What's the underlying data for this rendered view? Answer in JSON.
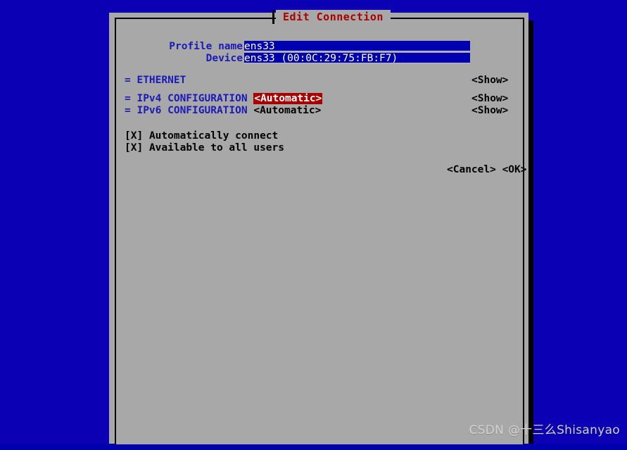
{
  "desktop": {
    "background_color": "#0b00b3"
  },
  "dialog": {
    "title": "Edit Connection",
    "title_color": "#aa0000",
    "panel_color": "#a8a8a8",
    "fields": {
      "profile_name": {
        "label": "Profile name",
        "value": "ens33",
        "filler": "_________________________________________",
        "placeholder": "Profile name"
      },
      "device": {
        "label": "Device",
        "value": "ens33 (00:0C:29:75:FB:F7)",
        "filler": "_____________________",
        "placeholder": "Device"
      }
    },
    "sections": [
      {
        "marker": "=",
        "label": "ETHERNET",
        "selector": "",
        "selector_active": false,
        "action": "<Show>"
      },
      {
        "marker": "=",
        "label": "IPv4 CONFIGURATION",
        "selector": "<Automatic>",
        "selector_active": true,
        "action": "<Show>"
      },
      {
        "marker": "=",
        "label": "IPv6 CONFIGURATION",
        "selector": "<Automatic>",
        "selector_active": false,
        "action": "<Show>"
      }
    ],
    "checkboxes": [
      {
        "box": "[X]",
        "label": "Automatically connect",
        "checked": true
      },
      {
        "box": "[X]",
        "label": "Available to all users",
        "checked": true
      }
    ],
    "buttons": {
      "cancel": "<Cancel>",
      "ok": "<OK>"
    },
    "colors": {
      "label_blue": "#1a1ab8",
      "field_background": "#0000b0",
      "field_text": "#ffffff",
      "highlight_background": "#aa0000",
      "highlight_text": "#ffffff"
    }
  },
  "watermark": {
    "text": "CSDN @十三么Shisanyao"
  }
}
